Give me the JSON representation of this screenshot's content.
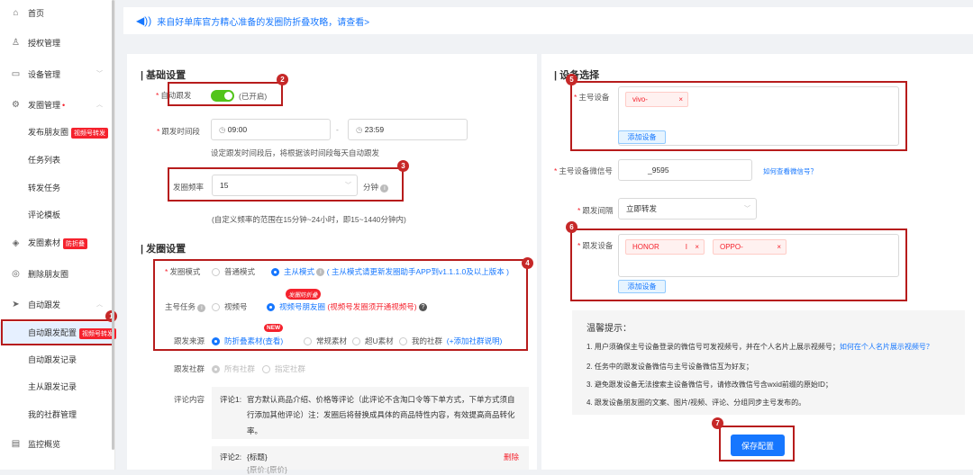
{
  "sidebar": {
    "items": [
      {
        "label": "首页",
        "icon": "home-icon"
      },
      {
        "label": "授权管理",
        "icon": "user-icon"
      },
      {
        "label": "设备管理",
        "icon": "monitor-icon"
      },
      {
        "label": "发圈管理",
        "icon": "settings-icon",
        "marker": "•"
      },
      {
        "label": "发布朋友圈",
        "tag": "视频号转发"
      },
      {
        "label": "任务列表"
      },
      {
        "label": "转发任务"
      },
      {
        "label": "评论模板"
      },
      {
        "label": "发圈素材",
        "icon": "layers-icon",
        "tag": "防折叠"
      },
      {
        "label": "删除朋友圈",
        "icon": "delete-icon"
      },
      {
        "label": "自动跟发",
        "icon": "send-icon"
      },
      {
        "label": "自动跟发配置",
        "tag": "视频号转发"
      },
      {
        "label": "自动跟发记录"
      },
      {
        "label": "主从跟发记录"
      },
      {
        "label": "我的社群管理"
      },
      {
        "label": "监控概览",
        "icon": "chart-icon"
      }
    ]
  },
  "banner": {
    "text": "来自好单库官方精心准备的发圈防折叠攻略，请查看>"
  },
  "basic": {
    "title": "基础设置",
    "auto_follow_label": "自动跟发",
    "auto_follow_state": "(已开启)",
    "time_label": "跟发时间段",
    "time_start": "09:00",
    "time_sep": "-",
    "time_end": "23:59",
    "time_hint": "设定跟发时间段后，将根据该时间段每天自动跟发",
    "freq_label": "发圈频率",
    "freq_value": "15",
    "freq_unit": "分钟",
    "freq_hint": "(自定义频率的范围在15分钟~24小时，即15~1440分钟内)"
  },
  "post": {
    "title": "发圈设置",
    "mode_label": "发圈模式",
    "mode_normal": "普通模式",
    "mode_master": "主从模式",
    "mode_note": "( 主从模式请更新发圈助手APP到v1.1.1.0及以上版本 )",
    "master_task_label": "主号任务",
    "task_video": "视频号",
    "task_moments": "视频号朋友圈",
    "task_note": "(视频号发圈须开通视频号)",
    "task_badge": "发圈防折叠",
    "source_label": "跟发来源",
    "source_anti": "防折叠素材",
    "source_view": "(查看)",
    "source_new": "NEW",
    "source_normal": "常规素材",
    "source_super": "超U素材",
    "source_my": "我的社群",
    "source_add": "(+添加社群说明)",
    "community_label": "跟发社群",
    "community_all": "所有社群",
    "community_spec": "指定社群",
    "comment_label": "评论内容",
    "comment1_label": "评论1:",
    "comment1_line1": "官方默认商品介绍、价格等评论（此评论不含淘口令等下单方式，下单方式须自",
    "comment1_line2": "行添加其他评论）注：发圈后将替换成具体的商品特性内容，有效提高商品转化",
    "comment1_line3": "率。",
    "comment2_label": "评论2:",
    "comment2_value": "{标题}",
    "comment2_extra": "{原价:{原价}",
    "delete_label": "删除"
  },
  "device": {
    "title": "设备选择",
    "main_label": "主号设备",
    "main_chip": "vivo-",
    "add_device": "添加设备",
    "wechat_label": "主号设备微信号",
    "wechat_value": "_9595",
    "wechat_link": "如何查看微信号？",
    "interval_label": "跟发间隔",
    "interval_value": "立即转发",
    "follow_label": "跟发设备",
    "follow_chip1": "HONOR",
    "follow_chip1_suffix": "I",
    "follow_chip2": "OPPO-",
    "add_device2": "添加设备"
  },
  "tips": {
    "title": "温馨提示：",
    "line1": "1. 用户须确保主号设备登录的微信号可发视频号，并在个人名片上展示视频号；",
    "line1_link": "如何在个人名片展示视频号？",
    "line2": "2. 任务中的跟发设备微信与主号设备微信互为好友；",
    "line3": "3. 避免跟发设备无法搜索主设备微信号，请修改微信号含wxid前缀的原始ID；",
    "line4": "4. 跟发设备朋友圈的文案、图片/视频、评论、分组同步主号发布的。"
  },
  "save_label": "保存配置",
  "markers": [
    "1",
    "2",
    "3",
    "4",
    "5",
    "6",
    "7"
  ],
  "colors": {
    "accent": "#1677ff",
    "annotation": "#b71c1c",
    "tag": "#f5222d",
    "toggle": "#52c41a"
  }
}
